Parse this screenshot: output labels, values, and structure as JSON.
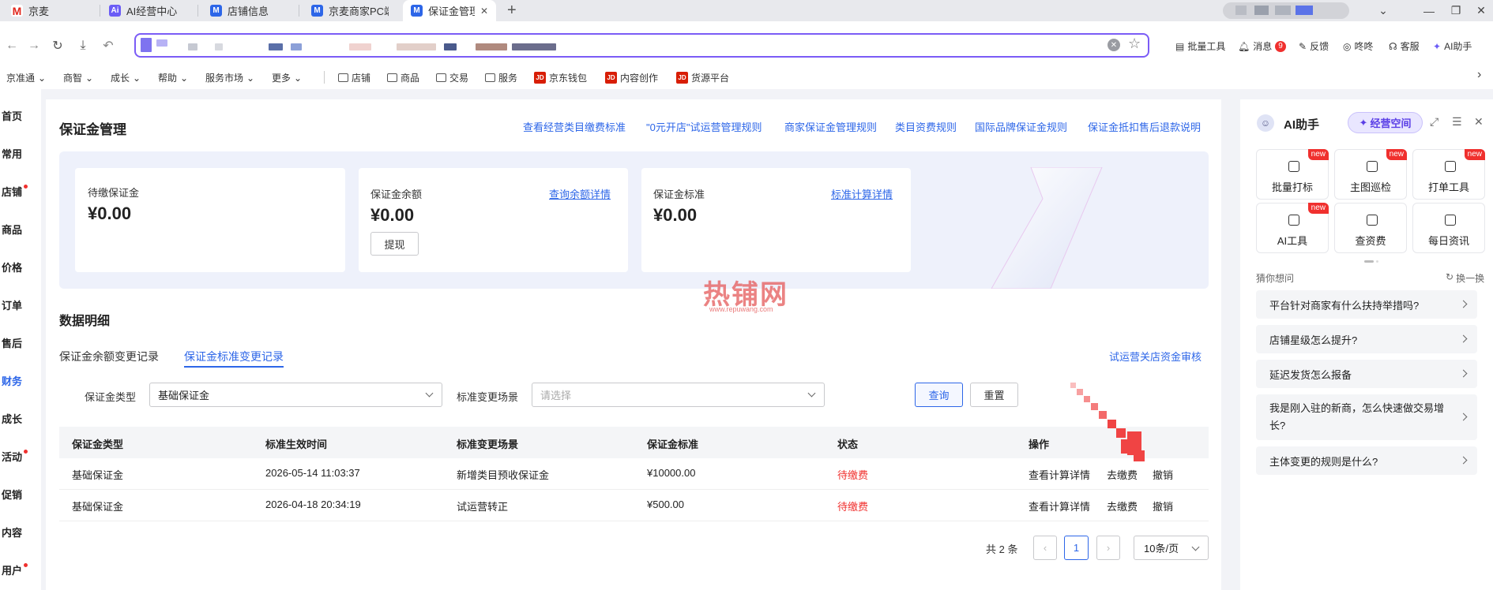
{
  "browser": {
    "tabs": [
      {
        "label": "京麦",
        "icon": "jd-m-icon",
        "color": "#e1251b"
      },
      {
        "label": "AI经营中心",
        "icon": "ai-icon",
        "color": "#6b5cf6"
      },
      {
        "label": "店铺信息",
        "icon": "m-icon",
        "color": "#2d66e8"
      },
      {
        "label": "京麦商家PC端",
        "icon": "m-icon",
        "color": "#2d66e8"
      },
      {
        "label": "保证金管理",
        "icon": "m-icon",
        "color": "#2d66e8",
        "active": true
      }
    ],
    "new_tab": "+",
    "right_tools": [
      "批量工具",
      "消息",
      "反馈",
      "咚咚",
      "客服",
      "AI助手"
    ],
    "message_badge": "9"
  },
  "bookmarks": {
    "menus": [
      "京准通",
      "商智",
      "成长",
      "帮助",
      "服务市场",
      "更多"
    ],
    "folders": [
      "店铺",
      "商品",
      "交易",
      "服务"
    ],
    "jd_links": [
      "京东钱包",
      "内容创作",
      "货源平台"
    ]
  },
  "leftnav": {
    "items": [
      "首页",
      "常用",
      "店铺",
      "商品",
      "价格",
      "订单",
      "售后",
      "财务",
      "成长",
      "活动",
      "促销",
      "内容",
      "用户"
    ],
    "active": "财务"
  },
  "page": {
    "title": "保证金管理",
    "header_links": [
      "查看经营类目缴费标准",
      "\"0元开店\"试运营管理规则",
      "商家保证金管理规则",
      "类目资费规则",
      "国际品牌保证金规则",
      "保证金抵扣售后退款说明"
    ],
    "cards": {
      "pending": {
        "label": "待缴保证金",
        "value": "¥0.00"
      },
      "balance": {
        "label": "保证金余额",
        "value": "¥0.00",
        "link": "查询余额详情",
        "button": "提现"
      },
      "standard": {
        "label": "保证金标准",
        "value": "¥0.00",
        "link": "标准计算详情"
      }
    },
    "section_title": "数据明细",
    "tabs": [
      "保证金余额变更记录",
      "保证金标准变更记录"
    ],
    "active_tab": "保证金标准变更记录",
    "audit_link": "试运营关店资金审核",
    "filters": {
      "type_label": "保证金类型",
      "type_value": "基础保证金",
      "scene_label": "标准变更场景",
      "scene_placeholder": "请选择",
      "query": "查询",
      "reset": "重置"
    },
    "table": {
      "headers": [
        "保证金类型",
        "标准生效时间",
        "标准变更场景",
        "保证金标准",
        "状态",
        "操作"
      ],
      "rows": [
        {
          "type": "基础保证金",
          "time": "2026-05-14 11:03:37",
          "scene": "新增类目预收保证金",
          "amount": "¥10000.00",
          "status": "待缴费",
          "actions": [
            "查看计算详情",
            "去缴费",
            "撤销"
          ]
        },
        {
          "type": "基础保证金",
          "time": "2026-04-18 20:34:19",
          "scene": "试运营转正",
          "amount": "¥500.00",
          "status": "待缴费",
          "actions": [
            "查看计算详情",
            "去缴费",
            "撤销"
          ]
        }
      ]
    },
    "pagination": {
      "total": "共 2 条",
      "current": "1",
      "page_size": "10条/页"
    },
    "watermark": {
      "text": "热铺网",
      "url": "www.repuwang.com"
    }
  },
  "assistant": {
    "title": "AI助手",
    "space_button": "经营空间",
    "tools": [
      {
        "label": "批量打标",
        "new": "new"
      },
      {
        "label": "主图巡检",
        "new": "new"
      },
      {
        "label": "打单工具",
        "new": "new"
      },
      {
        "label": "AI工具",
        "new": "new"
      },
      {
        "label": "查资费",
        "new": ""
      },
      {
        "label": "每日资讯",
        "new": ""
      }
    ],
    "guess_label": "猜你想问",
    "refresh_label": "换一换",
    "questions": [
      "平台针对商家有什么扶持举措吗?",
      "店铺星级怎么提升?",
      "延迟发货怎么报备",
      "我是刚入驻的新商，怎么快速做交易增长?",
      "主体变更的规则是什么?"
    ]
  }
}
